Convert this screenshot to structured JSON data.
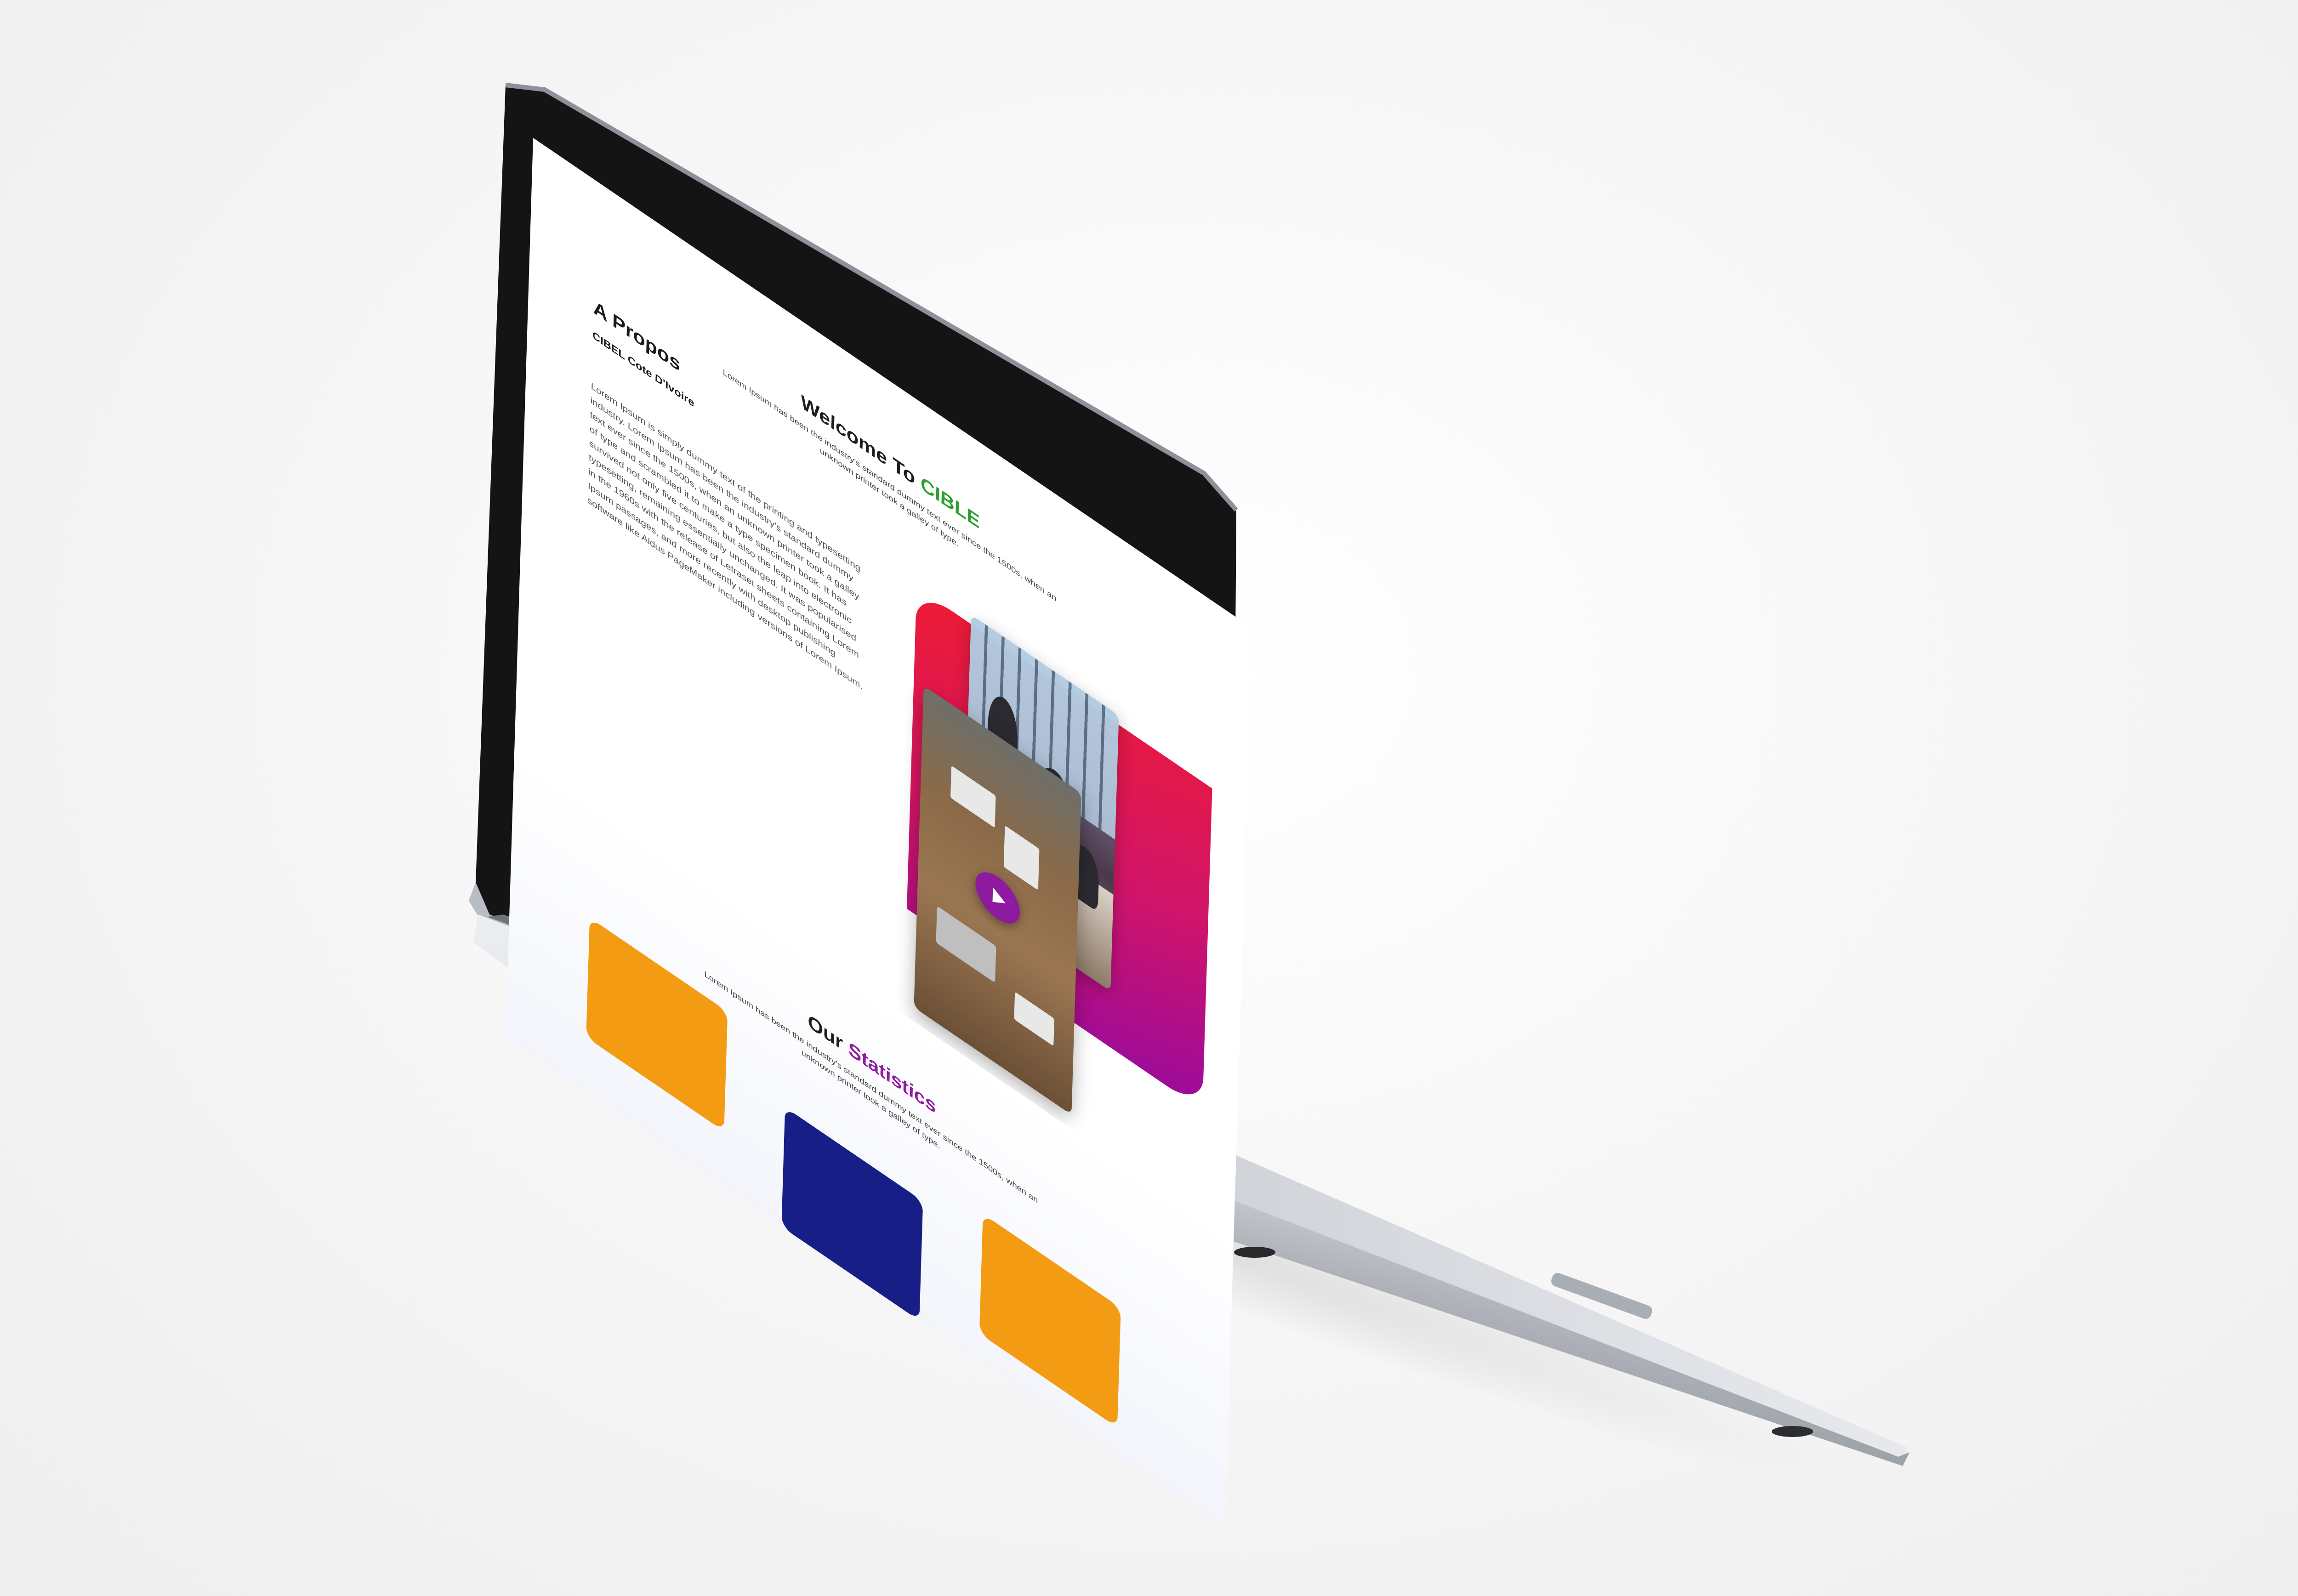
{
  "welcome": {
    "title_prefix": "Welcome To ",
    "title_accent": "CIBLE",
    "subtitle": "Lorem Ipsum has been the industry's standard dummy text ever since the 1500s, when an unknown printer took a galley of type."
  },
  "about": {
    "title": "A Propos",
    "subtitle": "CIBEL Cote D'Ivoire",
    "body": "Lorem Ipsum is simply dummy text of the printing and typesetting industry. Lorem Ipsum has been the industry's standard dummy text ever since the 1500s, when an unknown printer took a galley of type and scrambled it to make a type specimen book. It has survived not only five centuries, but also the leap into electronic typesetting, remaining essentially unchanged. It was popularised in the 1960s with the release of Letraset sheets containing Lorem Ipsum passages, and more recently with desktop publishing software like Aldus PageMaker including versions of Lorem Ipsum."
  },
  "media": {
    "play_icon": "play-icon",
    "gradient_colors": [
      "#ee1b33",
      "#d0146a",
      "#9a0a9c"
    ],
    "play_button_color": "#8e1aa0"
  },
  "statistics": {
    "title_prefix": "Our ",
    "title_accent": "Statistics",
    "subtitle": "Lorem Ipsum has been the industry's standard dummy text ever since the 1500s, when an unknown printer took a galley of type.",
    "card_colors": [
      "#f39b13",
      "#171f86",
      "#f39b13"
    ]
  },
  "colors": {
    "accent_green": "#2f9e2f",
    "accent_purple": "#8e1aa0"
  }
}
